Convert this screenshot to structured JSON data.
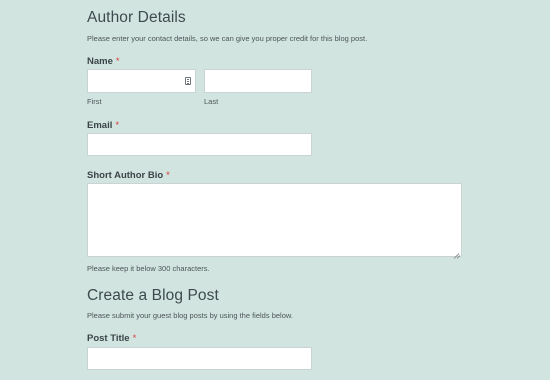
{
  "author_section": {
    "title": "Author Details",
    "description": "Please enter your contact details, so we can give you proper credit for this blog post."
  },
  "name_field": {
    "label": "Name",
    "required_mark": "*",
    "first": {
      "value": "",
      "sublabel": "First",
      "icon": "contact-card-icon"
    },
    "last": {
      "value": "",
      "sublabel": "Last"
    }
  },
  "email_field": {
    "label": "Email",
    "required_mark": "*",
    "value": ""
  },
  "bio_field": {
    "label": "Short Author Bio",
    "required_mark": "*",
    "value": "",
    "hint": "Please keep it below 300 characters."
  },
  "post_section": {
    "title": "Create a Blog Post",
    "description": "Please submit your guest blog posts by using the fields below."
  },
  "post_title_field": {
    "label": "Post Title",
    "required_mark": "*",
    "value": ""
  },
  "colors": {
    "background": "#d2e4df",
    "required": "#d63c3c",
    "text": "#3d4a4d",
    "input_bg": "#ffffff"
  }
}
